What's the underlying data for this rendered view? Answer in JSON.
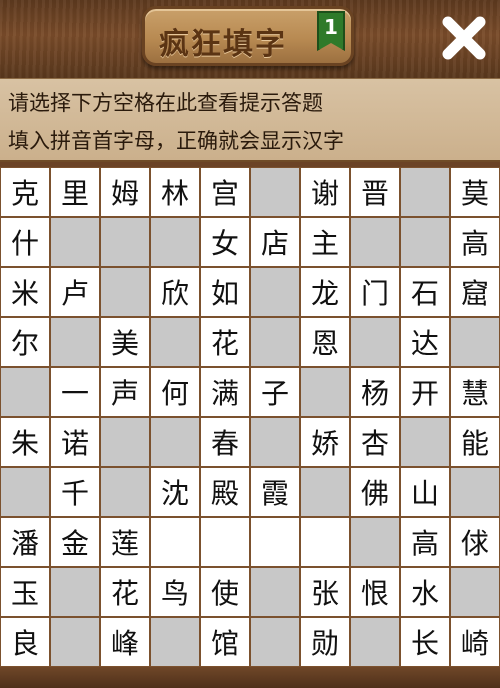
{
  "header": {
    "title": "疯狂填字",
    "level": "1",
    "close_icon": "close-x-icon"
  },
  "hint": {
    "line1": "请选择下方空格在此查看提示答题",
    "line2": "填入拼音首字母，正确就会显示汉字"
  },
  "colors": {
    "board_border": "#7b512e",
    "open_cell": "#ffffff",
    "blocked_cell": "#c8c8c8",
    "level_badge": "#2f7a2a"
  },
  "grid": [
    [
      "克",
      "里",
      "姆",
      "林",
      "宫",
      null,
      "谢",
      "晋",
      null,
      "莫"
    ],
    [
      "什",
      "",
      "",
      "",
      "女",
      "店",
      "主",
      "",
      "",
      "高"
    ],
    [
      "米",
      "卢",
      "",
      "欣",
      "如",
      "",
      "龙",
      "门",
      "石",
      "窟"
    ],
    [
      "尔",
      "",
      "美",
      "",
      "花",
      "",
      "恩",
      "",
      "达",
      ""
    ],
    [
      "",
      "一",
      "声",
      "何",
      "满",
      "子",
      "",
      "杨",
      "开",
      "慧"
    ],
    [
      "朱",
      "诺",
      "",
      "",
      "春",
      "",
      "娇",
      "杏",
      "",
      "能"
    ],
    [
      "",
      "千",
      "",
      "沈",
      "殿",
      "霞",
      "",
      "佛",
      "山",
      ""
    ],
    [
      "潘",
      "金",
      "莲",
      "",
      "",
      "",
      "",
      "",
      "高",
      "俅"
    ],
    [
      "玉",
      "",
      "花",
      "鸟",
      "使",
      "",
      "张",
      "恨",
      "水",
      ""
    ],
    [
      "良",
      "",
      "峰",
      "",
      "馆",
      "",
      "勋",
      "",
      "长",
      "崎"
    ]
  ],
  "open_mask": [
    [
      1,
      1,
      1,
      1,
      1,
      0,
      1,
      1,
      0,
      1
    ],
    [
      1,
      0,
      0,
      0,
      1,
      1,
      1,
      0,
      0,
      1
    ],
    [
      1,
      1,
      0,
      1,
      1,
      0,
      1,
      1,
      1,
      1
    ],
    [
      1,
      0,
      1,
      0,
      1,
      0,
      1,
      0,
      1,
      0
    ],
    [
      0,
      1,
      1,
      1,
      1,
      1,
      0,
      1,
      1,
      1
    ],
    [
      1,
      1,
      0,
      0,
      1,
      0,
      1,
      1,
      0,
      1
    ],
    [
      0,
      1,
      0,
      1,
      1,
      1,
      0,
      1,
      1,
      0
    ],
    [
      1,
      1,
      1,
      1,
      1,
      1,
      1,
      0,
      1,
      1
    ],
    [
      1,
      0,
      1,
      1,
      1,
      0,
      1,
      1,
      1,
      0
    ],
    [
      1,
      0,
      1,
      0,
      1,
      0,
      1,
      0,
      1,
      1
    ]
  ]
}
